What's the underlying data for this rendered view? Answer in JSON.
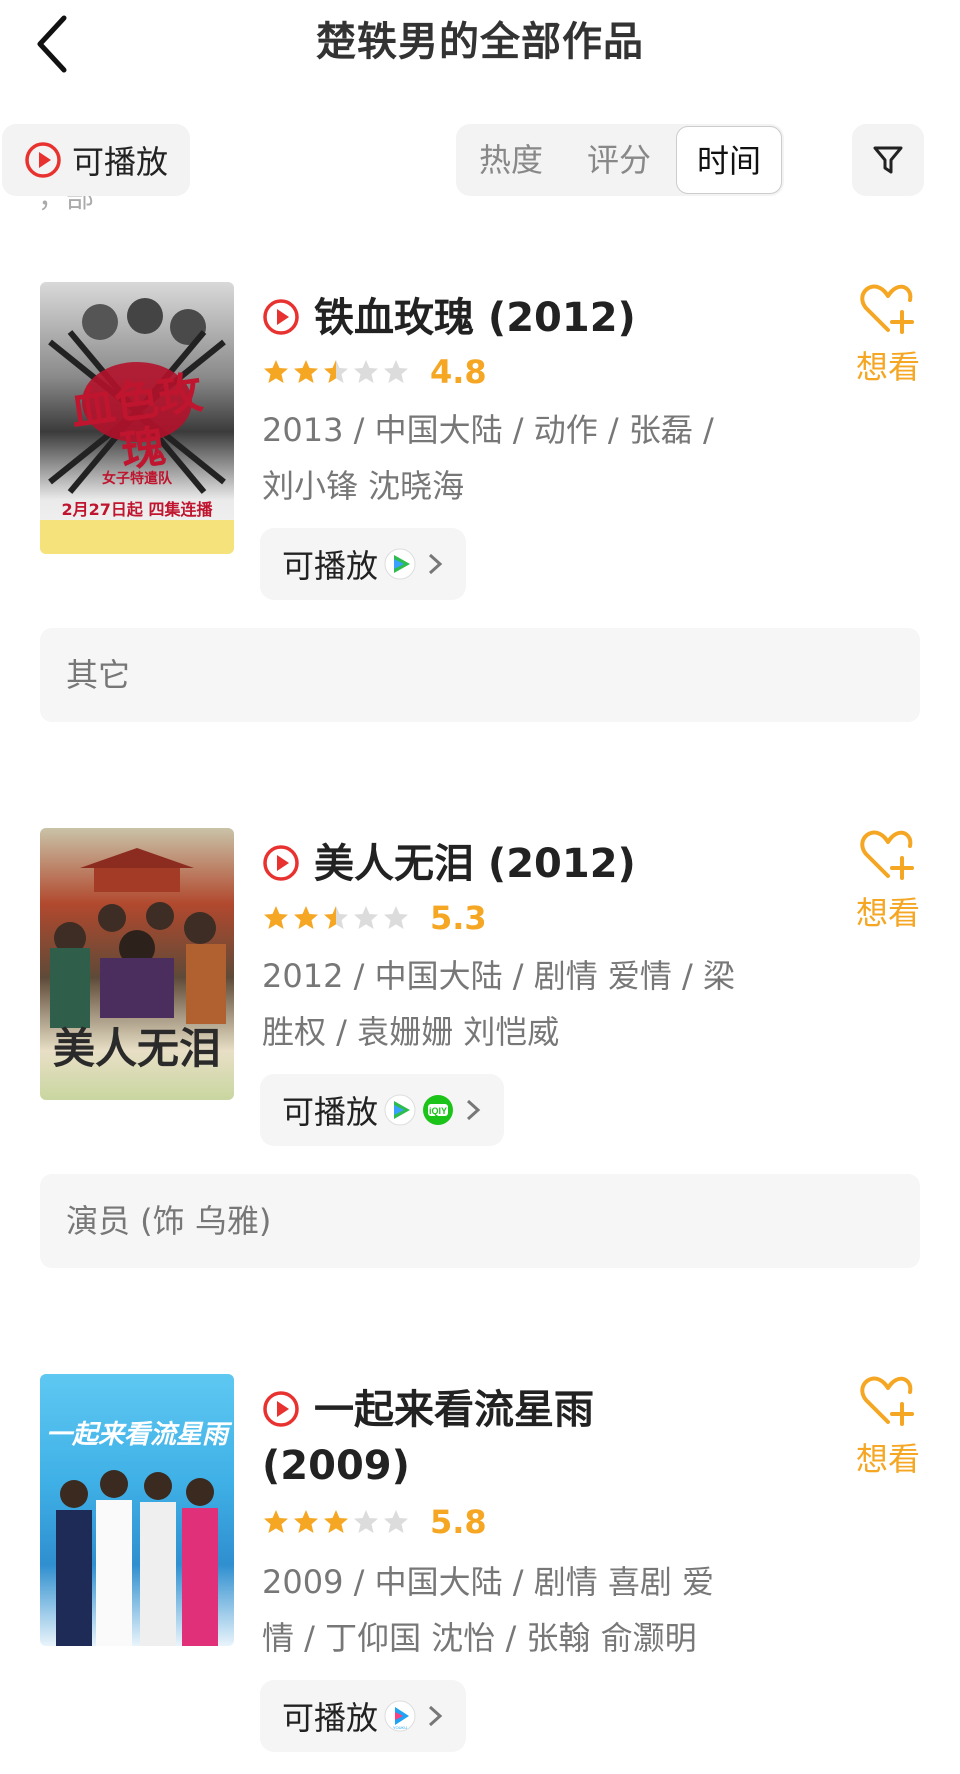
{
  "header": {
    "title": "楚轶男的全部作品",
    "back_icon": "chevron-left-icon"
  },
  "filters": {
    "playable_label": "可播放",
    "sort_tabs": [
      "热度",
      "评分",
      "时间"
    ],
    "active_sort": "时间",
    "filter_icon": "funnel-icon"
  },
  "top_clipped_text": "，部",
  "colors": {
    "accent": "#f5a623",
    "play_red": "#e8322f",
    "text_gray": "#777777"
  },
  "items": [
    {
      "title": "铁血玫瑰 (2012)",
      "rating": 2.5,
      "score": "4.8",
      "meta": "2013 / 中国大陆 / 动作 / 张磊 / 刘小锋 沈晓海",
      "play_label": "可播放",
      "sources": [
        "tencent-video-icon"
      ],
      "want_label": "想看",
      "role": "其它",
      "poster_text": "血色玫瑰",
      "poster_sub": "女子特遣队",
      "poster_date": "2月27日起 四集连播"
    },
    {
      "title": "美人无泪 (2012)",
      "rating": 2.5,
      "score": "5.3",
      "meta": "2012 / 中国大陆 / 剧情 爱情 / 梁胜权 / 袁姗姗 刘恺威",
      "play_label": "可播放",
      "sources": [
        "tencent-video-icon",
        "iqiyi-icon"
      ],
      "want_label": "想看",
      "role": "演员 (饰 乌雅)",
      "poster_text": "美人无泪"
    },
    {
      "title": "一起来看流星雨 (2009)",
      "rating": 3,
      "score": "5.8",
      "meta": "2009 / 中国大陆 / 剧情 喜剧 爱情 / 丁仰国 沈怡 / 张翰 俞灏明",
      "play_label": "可播放",
      "sources": [
        "youku-icon"
      ],
      "want_label": "想看",
      "poster_text": "一起来看流星雨",
      "iqiyi_text": "iQIY",
      "youku_text": "YOUKU"
    }
  ]
}
